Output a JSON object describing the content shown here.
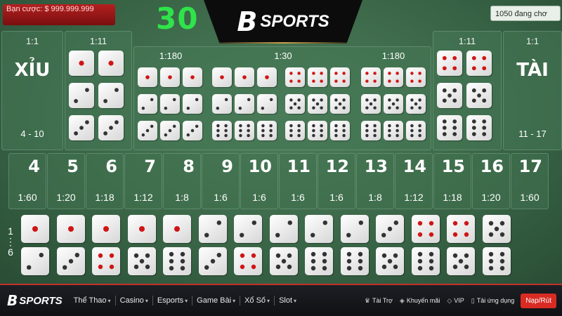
{
  "header": {
    "bet_label": "Bạn cược: $ 999.999.999",
    "timer": "30",
    "online": "1050 đang chơ",
    "logo_text": "SPORTS",
    "logo_letter": "B"
  },
  "board": {
    "xiu": {
      "ratio": "1:1",
      "label": "XỈU",
      "range": "4 - 10"
    },
    "tai": {
      "ratio": "1:1",
      "label": "TÀI",
      "range": "11 - 17"
    },
    "left_double": {
      "ratio": "1:11",
      "dice": [
        [
          1,
          1
        ],
        [
          2,
          2
        ],
        [
          3,
          3
        ]
      ]
    },
    "right_double": {
      "ratio": "1:11",
      "dice": [
        [
          4,
          4
        ],
        [
          5,
          5
        ],
        [
          6,
          6
        ]
      ]
    },
    "triple_groups": [
      {
        "ratio": "1:180",
        "dice": [
          [
            1,
            1,
            1
          ],
          [
            2,
            2,
            2
          ],
          [
            3,
            3,
            3
          ]
        ]
      },
      {
        "ratio": "1:30",
        "dice": [
          [
            1,
            1,
            1
          ],
          [
            2,
            2,
            2
          ],
          [
            6,
            6,
            6
          ]
        ]
      },
      {
        "ratio": "1:30",
        "dice": [
          [
            4,
            4,
            4
          ],
          [
            5,
            5,
            5
          ],
          [
            6,
            6,
            6
          ]
        ]
      },
      {
        "ratio": "1:180",
        "dice": [
          [
            4,
            4,
            4
          ],
          [
            5,
            5,
            5
          ],
          [
            6,
            6,
            6
          ]
        ]
      }
    ],
    "totals": [
      {
        "num": "4",
        "odds": "1:60"
      },
      {
        "num": "5",
        "odds": "1:20"
      },
      {
        "num": "6",
        "odds": "1:18"
      },
      {
        "num": "7",
        "odds": "1:12"
      },
      {
        "num": "8",
        "odds": "1:8"
      },
      {
        "num": "9",
        "odds": "1:6"
      },
      {
        "num": "10",
        "odds": "1:6"
      },
      {
        "num": "11",
        "odds": "1:6"
      },
      {
        "num": "12",
        "odds": "1:6"
      },
      {
        "num": "13",
        "odds": "1:8"
      },
      {
        "num": "14",
        "odds": "1:12"
      },
      {
        "num": "15",
        "odds": "1:18"
      },
      {
        "num": "16",
        "odds": "1:20"
      },
      {
        "num": "17",
        "odds": "1:60"
      }
    ],
    "left_marker": {
      "top": "1",
      "dots": "⋮",
      "bottom": "6"
    },
    "combo_row_top": [
      1,
      1,
      1,
      1,
      1,
      2,
      2,
      2,
      2,
      2,
      3,
      4,
      4,
      5
    ],
    "combo_row_bottom": [
      2,
      3,
      4,
      5,
      6,
      3,
      4,
      5,
      6,
      6,
      5,
      6,
      5,
      6
    ]
  },
  "nav": {
    "logo_letter": "B",
    "logo_text": "SPORTS",
    "items": [
      {
        "label": "Thể Thao",
        "caret": "▾"
      },
      {
        "label": "Casino",
        "caret": "▾"
      },
      {
        "label": "Esports",
        "caret": "▾"
      },
      {
        "label": "Game Bài",
        "caret": "▾"
      },
      {
        "label": "Xổ Số",
        "caret": "▾"
      },
      {
        "label": "Slot",
        "caret": "▾"
      }
    ],
    "right": [
      {
        "icon": "♛",
        "label": "Tài Trợ"
      },
      {
        "icon": "◈",
        "label": "Khuyến mãi"
      },
      {
        "icon": "◇",
        "label": "VIP"
      },
      {
        "icon": "▯",
        "label": "Tải ứng dụng"
      }
    ],
    "cta": "Nạp/Rút"
  },
  "colors": {
    "pip_red": "#d01515",
    "pip_dark": "#333333",
    "timer": "#2fe34a",
    "accent": "#d92b23"
  }
}
